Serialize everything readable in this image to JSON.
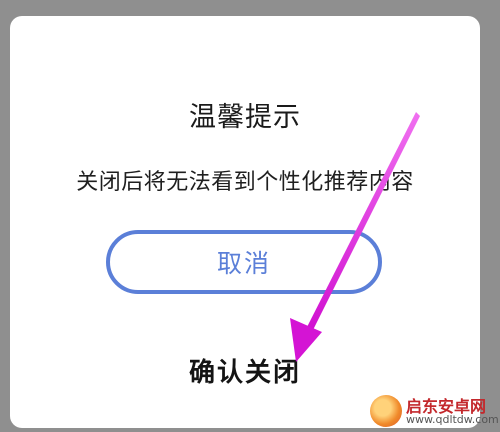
{
  "dialog": {
    "title": "温馨提示",
    "message": "关闭后将无法看到个性化推荐内容",
    "cancel_label": "取消",
    "confirm_label": "确认关闭"
  },
  "watermark": {
    "name": "启东安卓网",
    "url": "www.qdltdw.com"
  },
  "colors": {
    "accent": "#5b7fd8",
    "arrow": "#e020d0"
  }
}
